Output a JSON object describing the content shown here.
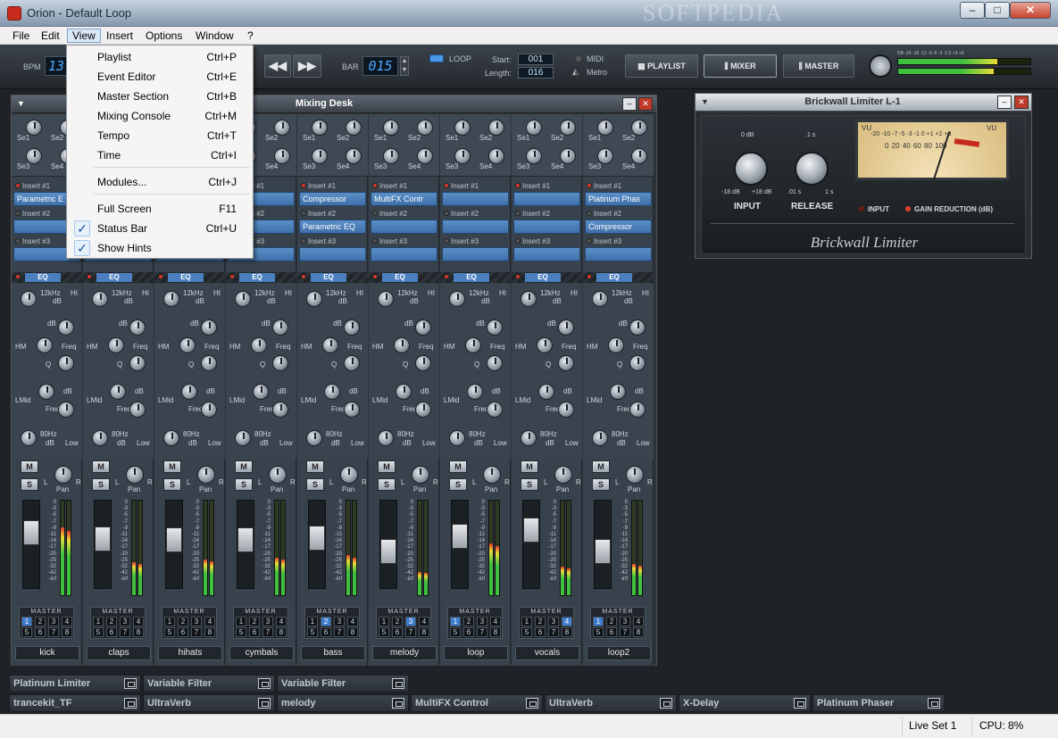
{
  "window": {
    "title": "Orion - Default Loop",
    "watermark": "SOFTPEDIA",
    "minimize": "–",
    "maximize": "□",
    "close": "✕"
  },
  "menubar": [
    "File",
    "Edit",
    "View",
    "Insert",
    "Options",
    "Window",
    "?"
  ],
  "view_menu": {
    "items": [
      {
        "label": "Playlist",
        "shortcut": "Ctrl+P",
        "checked": false
      },
      {
        "label": "Event Editor",
        "shortcut": "Ctrl+E",
        "checked": false
      },
      {
        "label": "Master Section",
        "shortcut": "Ctrl+B",
        "checked": false
      },
      {
        "label": "Mixing Console",
        "shortcut": "Ctrl+M",
        "checked": false
      },
      {
        "label": "Tempo",
        "shortcut": "Ctrl+T",
        "checked": false
      },
      {
        "label": "Time",
        "shortcut": "Ctrl+I",
        "checked": false
      },
      {
        "label": "Modules...",
        "shortcut": "Ctrl+J",
        "checked": false
      },
      {
        "label": "Full Screen",
        "shortcut": "F11",
        "checked": false
      },
      {
        "label": "Status Bar",
        "shortcut": "Ctrl+U",
        "checked": true
      },
      {
        "label": "Show Hints",
        "shortcut": "",
        "checked": true
      }
    ],
    "check_glyph": "✓"
  },
  "toolbar": {
    "bpm_label": "BPM",
    "bpm_value": "13",
    "bar_label": "BAR",
    "bar_value": "015",
    "loop_label": "LOOP",
    "start_label": "Start:",
    "start_value": "001",
    "length_label": "Length:",
    "length_value": "016",
    "midi_label": "MIDI",
    "metro_label": "Metro",
    "playlist_btn": "PLAYLIST",
    "mixer_btn": "MIXER",
    "master_btn": "MASTER",
    "meter_scale": "DB -24 -18 -12 -9 -6 -3 -1 0 +3 +6"
  },
  "mixing_desk": {
    "title": "Mixing Desk",
    "send_labels": [
      "Se1",
      "Se2",
      "Se3",
      "Se4"
    ],
    "insert_labels": [
      "Insert #1",
      "Insert #2",
      "Insert #3"
    ],
    "eq_label": "EQ",
    "eq_labels": {
      "hi_freq": "12kHz",
      "hi": "HI",
      "db": "dB",
      "hm": "HM",
      "freq": "Freq",
      "q": "Q",
      "lmid": "LMid",
      "low_freq": "80Hz",
      "low": "Low"
    },
    "mute": "M",
    "solo": "S",
    "pan": "Pan",
    "pan_l": "L",
    "pan_r": "R",
    "master_label": "MASTER",
    "route_nums": [
      "1",
      "2",
      "3",
      "4",
      "5",
      "6",
      "7",
      "8"
    ],
    "meter_scale": [
      "0",
      "-3",
      "-5",
      "-7",
      "-9",
      "-11",
      "-14",
      "-17",
      "-20",
      "-25",
      "-32",
      "-42",
      "-inf"
    ],
    "channels": [
      {
        "name": "kick",
        "inserts": [
          "Parametric E",
          "",
          ""
        ],
        "route": 1,
        "meter": 0.72
      },
      {
        "name": "claps",
        "inserts": [
          "",
          "",
          ""
        ],
        "route": 0,
        "meter": 0.35
      },
      {
        "name": "hihats",
        "inserts": [
          "",
          "",
          ""
        ],
        "route": 0,
        "meter": 0.38
      },
      {
        "name": "cymbals",
        "inserts": [
          "",
          "",
          ""
        ],
        "route": 0,
        "meter": 0.4
      },
      {
        "name": "bass",
        "inserts": [
          "Compressor",
          "Parametric EQ",
          ""
        ],
        "route": 2,
        "meter": 0.42
      },
      {
        "name": "melody",
        "inserts": [
          "MultiFX Contr",
          "",
          ""
        ],
        "route": 3,
        "meter": 0.25
      },
      {
        "name": "loop",
        "inserts": [
          "",
          "",
          ""
        ],
        "route": 1,
        "meter": 0.55
      },
      {
        "name": "vocals",
        "inserts": [
          "",
          "",
          ""
        ],
        "route": 4,
        "meter": 0.3
      },
      {
        "name": "loop2",
        "inserts": [
          "Platinum Phas",
          "Compressor",
          ""
        ],
        "route": 1,
        "meter": 0.33
      }
    ]
  },
  "limiter": {
    "title": "Brickwall Limiter L-1",
    "input_top": "0 dB",
    "input_min": "-18 dB",
    "input_max": "+18 dB",
    "input_label": "INPUT",
    "release_top": ".1 s",
    "release_min": ".01 s",
    "release_max": "1 s",
    "release_label": "RELEASE",
    "vu_label": "VU",
    "vu_scale_top": "-20 -10 -7 -5 -3 -1 0 +1 +2 +3",
    "vu_scale_bottom": "0 20 40 60 80 100",
    "input_radio": "INPUT",
    "gain_radio": "GAIN REDUCTION (dB)",
    "brand": "Brickwall Limiter"
  },
  "plugins_row1": [
    "Platinum Limiter",
    "Variable Filter",
    "Variable Filter"
  ],
  "plugins_row2": [
    "trancekit_TF",
    "UltraVerb",
    "melody",
    "MultiFX Control",
    "UltraVerb",
    "X-Delay",
    "Platinum Phaser"
  ],
  "statusbar": {
    "liveset": "Live Set 1",
    "cpu": "CPU: 8%"
  }
}
